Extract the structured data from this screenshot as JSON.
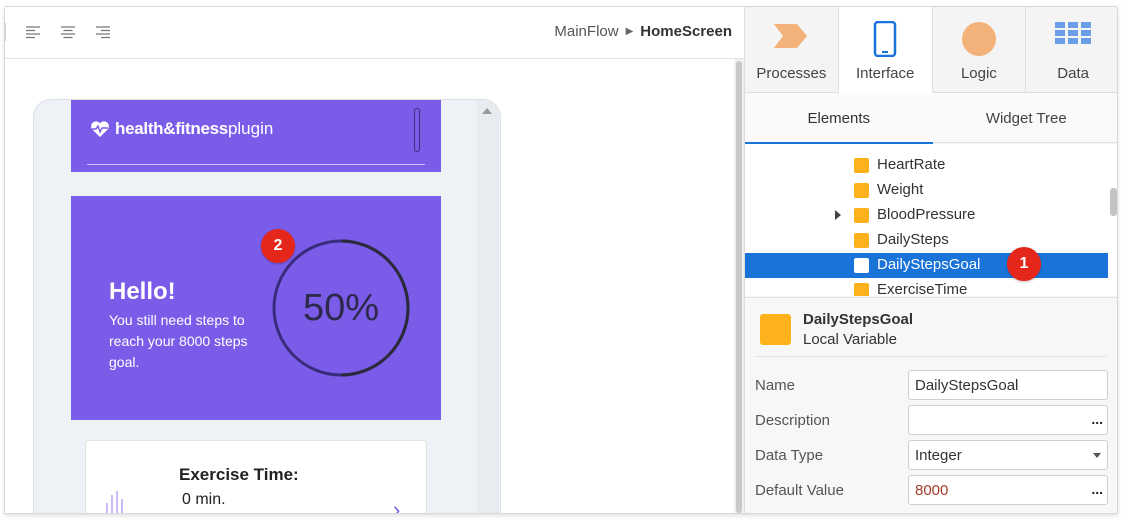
{
  "toolbar": {
    "breadcrumb": {
      "flow": "MainFlow",
      "screen": "HomeScreen"
    }
  },
  "phone": {
    "logo_bold": "health&fitness",
    "logo_light": "plugin",
    "hello_title": "Hello!",
    "hello_text": "You still need  steps to reach your 8000 steps goal.",
    "progress_label": "50%",
    "progress_fraction": 0.5,
    "exercise_title": "Exercise Time:",
    "exercise_value": "0 min."
  },
  "badges": {
    "badge1": "1",
    "badge2": "2"
  },
  "panel": {
    "tabs": [
      {
        "label": "Processes",
        "icon": "processes-icon"
      },
      {
        "label": "Interface",
        "icon": "interface-icon"
      },
      {
        "label": "Logic",
        "icon": "logic-icon"
      },
      {
        "label": "Data",
        "icon": "data-icon"
      }
    ],
    "active_tab": "Interface",
    "subtabs": {
      "elements": "Elements",
      "widget_tree": "Widget Tree"
    },
    "tree": [
      {
        "label": "HeartRate"
      },
      {
        "label": "Weight"
      },
      {
        "label": "BloodPressure"
      },
      {
        "label": "DailySteps"
      },
      {
        "label": "DailyStepsGoal"
      },
      {
        "label": "ExerciseTime"
      }
    ],
    "selected_item": "DailyStepsGoal",
    "properties": {
      "title": "DailyStepsGoal",
      "subtitle": "Local Variable",
      "name_label": "Name",
      "name_value": "DailyStepsGoal",
      "description_label": "Description",
      "description_value": "",
      "datatype_label": "Data Type",
      "datatype_value": "Integer",
      "default_label": "Default Value",
      "default_value": "8000",
      "ellipsis": "..."
    }
  },
  "colors": {
    "brand_purple": "#7b5ce9",
    "selection_blue": "#1a73d9",
    "variable_orange": "#fdb21b",
    "badge_red": "#e5261b"
  }
}
